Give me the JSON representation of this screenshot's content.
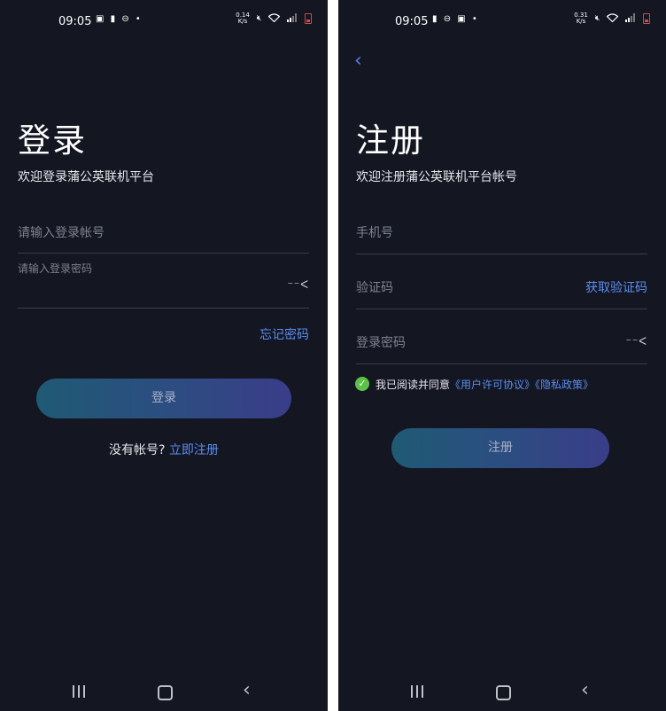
{
  "login": {
    "status": {
      "time": "09:05",
      "speed_top": "0.14",
      "speed_bottom": "K/s"
    },
    "title": "登录",
    "subtitle": "欢迎登录蒲公英联机平台",
    "account_placeholder": "请输入登录帐号",
    "password_label": "请输入登录密码",
    "eye_glyph": "⁻⁻ᐸ",
    "forgot": "忘记密码",
    "login_button": "登录",
    "no_account": "没有帐号?",
    "register_link": "立即注册"
  },
  "register": {
    "status": {
      "time": "09:05",
      "speed_top": "0.31",
      "speed_bottom": "K/s"
    },
    "title": "注册",
    "subtitle": "欢迎注册蒲公英联机平台帐号",
    "phone_placeholder": "手机号",
    "code_placeholder": "验证码",
    "get_code": "获取验证码",
    "password_placeholder": "登录密码",
    "eye_glyph": "⁻⁻ᐸ",
    "agree_text": "我已阅读并同意",
    "license_link": "《用户许可协议》",
    "privacy_link": "《隐私政策》",
    "register_button": "注册"
  },
  "colors": {
    "background": "#141622",
    "accent": "#5b8def",
    "check": "#5ac246"
  },
  "icons": [
    "gallery-icon",
    "battery-saver-icon",
    "dnd-icon",
    "mute-icon",
    "wifi-icon",
    "signal-icon",
    "battery-icon",
    "back-arrow-icon",
    "eye-closed-icon",
    "check-icon",
    "recent-apps-icon",
    "home-icon",
    "nav-back-icon"
  ]
}
